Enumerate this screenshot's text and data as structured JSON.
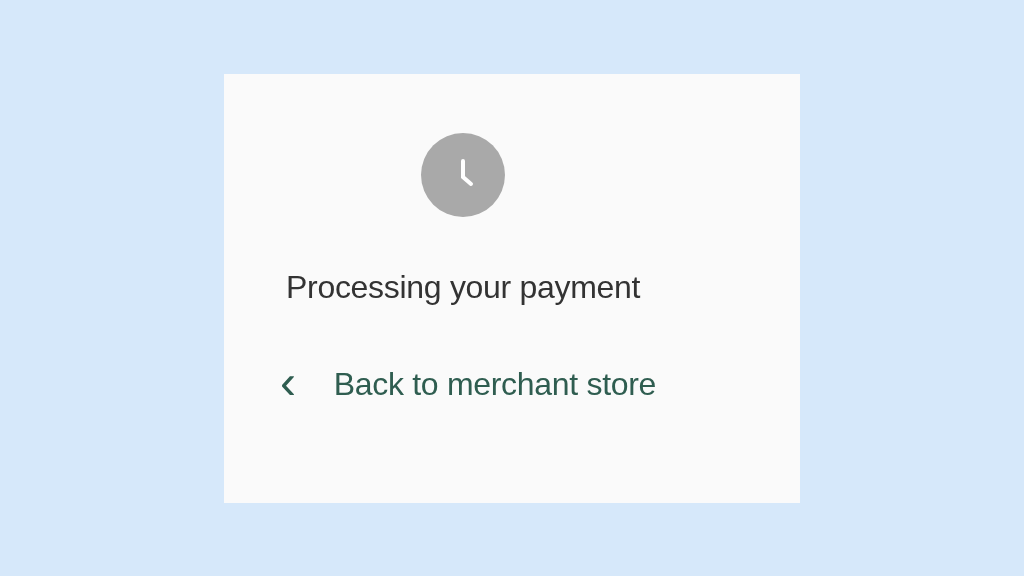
{
  "status": {
    "title": "Processing your payment"
  },
  "back_link": {
    "icon": "‹",
    "label": "Back to merchant store"
  }
}
